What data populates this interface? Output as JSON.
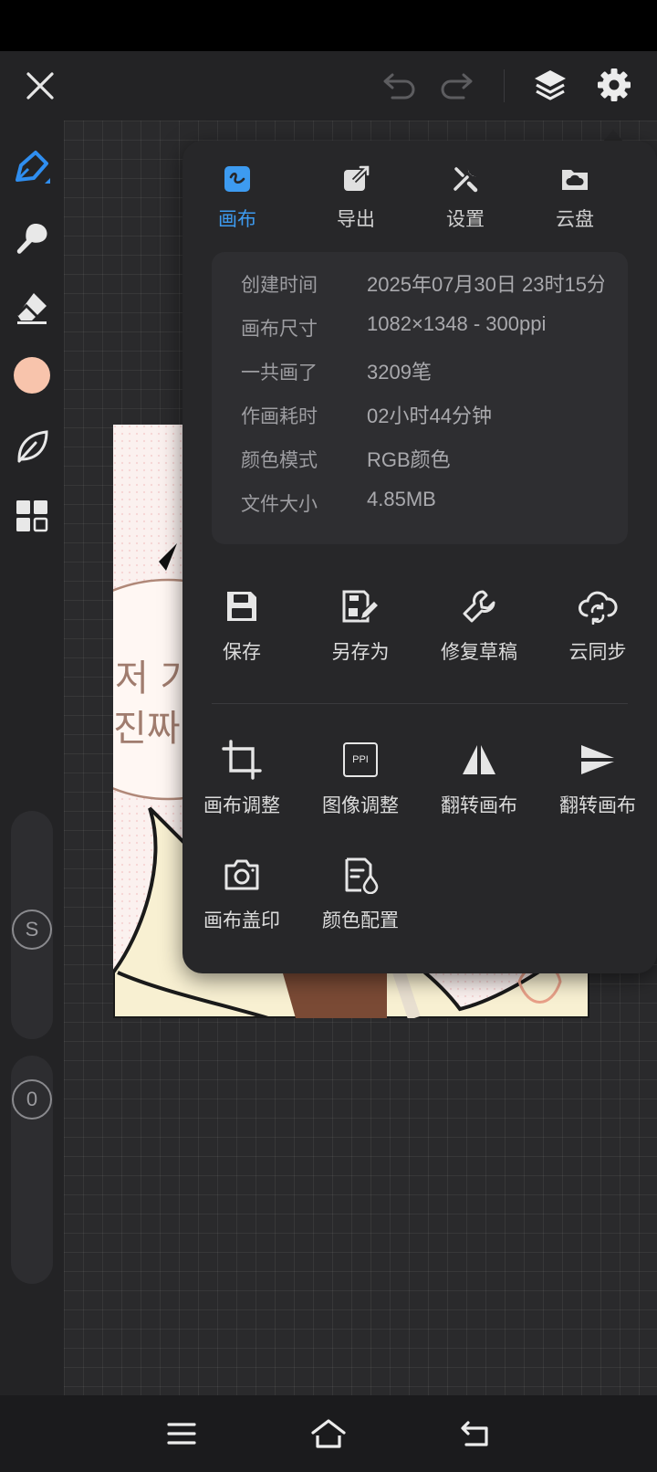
{
  "colors": {
    "accent": "#3d9bf0",
    "brush_color": "#f8c4ac",
    "panel_bg": "#272729"
  },
  "toolbar": {
    "close_icon": "close-icon",
    "undo_icon": "undo-icon",
    "redo_icon": "redo-icon",
    "layers_icon": "layers-icon",
    "settings_icon": "gear-icon"
  },
  "left_tools": [
    "pen-icon",
    "smudge-icon",
    "eraser-icon",
    "color-swatch",
    "leaf-icon",
    "grid-icon"
  ],
  "sliders": {
    "size_label": "S",
    "opacity_label": "0"
  },
  "artwork": {
    "bubble_line1": "저 가",
    "bubble_line2": "진짜 O"
  },
  "panel": {
    "tabs": [
      {
        "label": "画布",
        "icon": "canvas-icon",
        "active": true
      },
      {
        "label": "导出",
        "icon": "export-icon",
        "active": false
      },
      {
        "label": "设置",
        "icon": "tools-icon",
        "active": false
      },
      {
        "label": "云盘",
        "icon": "cloud-folder-icon",
        "active": false
      }
    ],
    "info": [
      {
        "key": "创建时间",
        "value": "2025年07月30日 23时15分"
      },
      {
        "key": "画布尺寸",
        "value": "1082×1348 - 300ppi"
      },
      {
        "key": "一共画了",
        "value": "3209笔"
      },
      {
        "key": "作画耗时",
        "value": "02小时44分钟"
      },
      {
        "key": "颜色模式",
        "value": "RGB颜色"
      },
      {
        "key": "文件大小",
        "value": "4.85MB"
      }
    ],
    "actions_row1": [
      {
        "label": "保存",
        "icon": "save-icon"
      },
      {
        "label": "另存为",
        "icon": "save-as-icon"
      },
      {
        "label": "修复草稿",
        "icon": "wrench-icon"
      },
      {
        "label": "云同步",
        "icon": "cloud-sync-icon"
      }
    ],
    "actions_row2": [
      {
        "label": "画布调整",
        "icon": "crop-icon"
      },
      {
        "label": "图像调整",
        "icon": "ppi-icon",
        "icon_text": "PPI"
      },
      {
        "label": "翻转画布",
        "icon": "flip-horizontal-icon"
      },
      {
        "label": "翻转画布",
        "icon": "flip-vertical-icon"
      }
    ],
    "actions_row3": [
      {
        "label": "画布盖印",
        "icon": "camera-icon"
      },
      {
        "label": "颜色配置",
        "icon": "color-profile-icon"
      }
    ]
  },
  "navbar": {
    "menu_icon": "menu-icon",
    "home_icon": "home-icon",
    "back_icon": "back-icon"
  }
}
